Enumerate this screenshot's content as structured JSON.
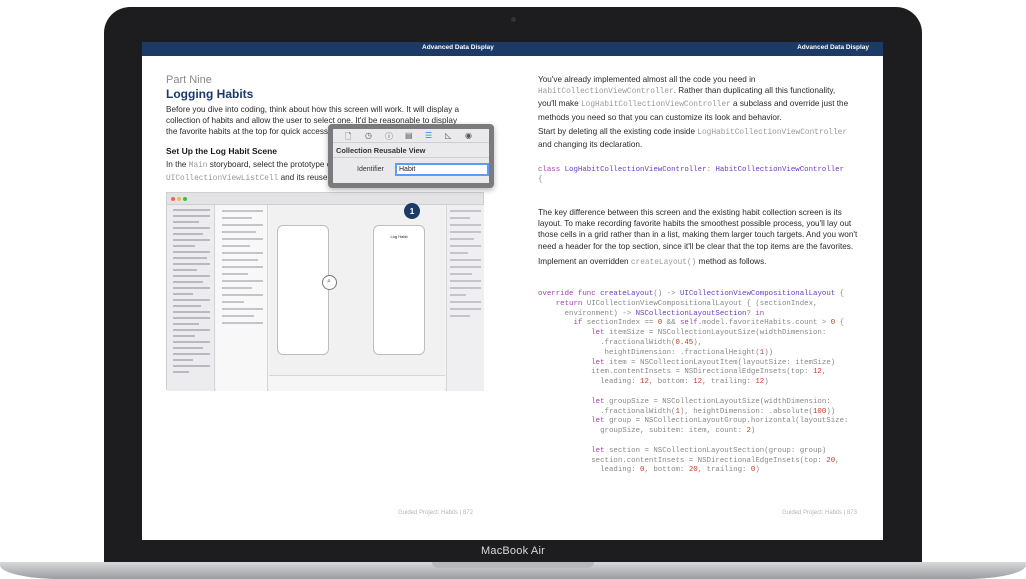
{
  "device": {
    "label": "MacBook Air"
  },
  "header": {
    "left": "Advanced Data Display",
    "right": "Advanced Data Display"
  },
  "left_page": {
    "part": "Part Nine",
    "title": "Logging Habits",
    "intro": "Before you dive into coding, think about how this screen will work. It will display a collection of habits and allow the user to select one. It'd be reasonable to display the favorite habits at the top for quick access.",
    "section_title": "Set Up the Log Habit Scene",
    "section_text_a": "In the ",
    "section_code_a": "Main",
    "section_text_b": " storyboard, select the prototype c",
    "section_code_b": "UICollectionViewListCell",
    "section_text_c": " and its reuse",
    "screenshot": {
      "phone_title": "Log Habit",
      "callout_number": "1"
    },
    "popup": {
      "icons": [
        "doc-icon",
        "clock-icon",
        "help-icon",
        "identity-icon",
        "attributes-icon",
        "ruler-icon",
        "connections-icon"
      ],
      "title": "Collection Reusable View",
      "field_label": "Identifier",
      "field_value": "Habit"
    },
    "footer": "Guided Project: Habits  |  872"
  },
  "right_page": {
    "p1_a": "You've already implemented almost all the code you need in",
    "p1_code_a": "HabitCollectionViewController",
    "p1_b": ". Rather than duplicating all this functionality,",
    "p1_c": "you'll make ",
    "p1_code_b": "LogHabitCollectionViewController",
    "p1_d": " a subclass and override just the",
    "p1_e": "methods you need so that you can customize its look and behavior.",
    "p2_a": "Start by deleting all the existing code inside ",
    "p2_code": "LogHabitCollectionViewController",
    "p2_b": "and changing its declaration.",
    "p3": "The key difference between this screen and the existing habit collection screen is its layout. To make recording favorite habits the smoothest possible process, you'll lay out those cells in a grid rather than in a list, making them larger touch targets. And you won't need a header for the top section, since it'll be clear that the top items are the favorites.",
    "p4_a": "Implement an overridden ",
    "p4_code": "createLayout()",
    "p4_b": " method as follows.",
    "footer": "Guided Project: Habits  |  873"
  }
}
